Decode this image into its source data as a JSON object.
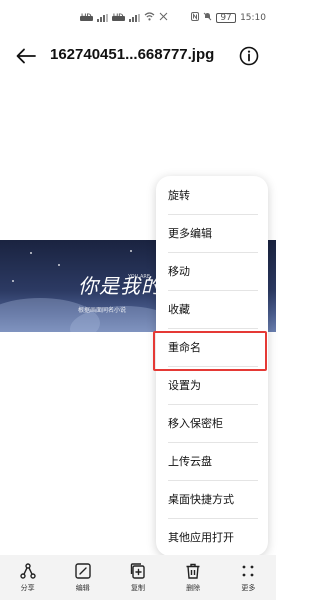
{
  "status_bar": {
    "sim1_tag": "HD",
    "sim2_tag": "HD",
    "time": "15:10",
    "battery": "97"
  },
  "header": {
    "title": "162740451...668777.jpg"
  },
  "photo": {
    "overlay_text": "你是我的",
    "overlay_sub": "YOU ARE",
    "overlay_caption": "根据画面同名小说"
  },
  "menu": {
    "items": [
      {
        "label": "旋转"
      },
      {
        "label": "更多编辑"
      },
      {
        "label": "移动"
      },
      {
        "label": "收藏"
      },
      {
        "label": "重命名"
      },
      {
        "label": "设置为"
      },
      {
        "label": "移入保密柜"
      },
      {
        "label": "上传云盘"
      },
      {
        "label": "桌面快捷方式"
      },
      {
        "label": "其他应用打开"
      }
    ],
    "highlighted_index": 4,
    "highlight_color": "#e53935"
  },
  "toolbar": {
    "items": [
      {
        "label": "分享",
        "icon": "share-icon"
      },
      {
        "label": "编辑",
        "icon": "edit-icon"
      },
      {
        "label": "复制",
        "icon": "copy-icon"
      },
      {
        "label": "删除",
        "icon": "delete-icon"
      },
      {
        "label": "更多",
        "icon": "more-icon"
      }
    ]
  }
}
